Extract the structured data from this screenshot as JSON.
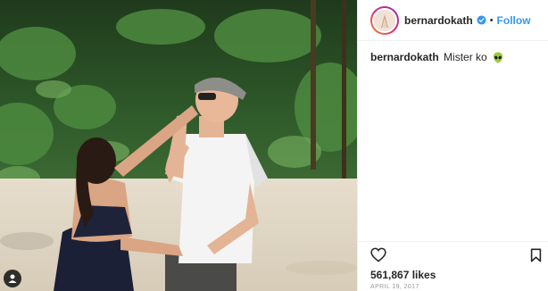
{
  "post": {
    "photo": {
      "description_icon": "tagged-user-icon"
    },
    "header": {
      "username": "bernardokath",
      "verified_icon": "verified-badge-icon",
      "separator": "•",
      "follow_label": "Follow"
    },
    "caption": {
      "username": "bernardokath",
      "text": "Mister ko",
      "emoji_icon": "alien-emoji-icon"
    },
    "actions": {
      "like_icon": "heart-icon",
      "save_icon": "bookmark-icon"
    },
    "likes": "561,867 likes",
    "date": "APRIL 19, 2017"
  },
  "colors": {
    "link_blue": "#3897f0",
    "text": "#262626",
    "muted": "#999999",
    "divider": "#efefef"
  }
}
